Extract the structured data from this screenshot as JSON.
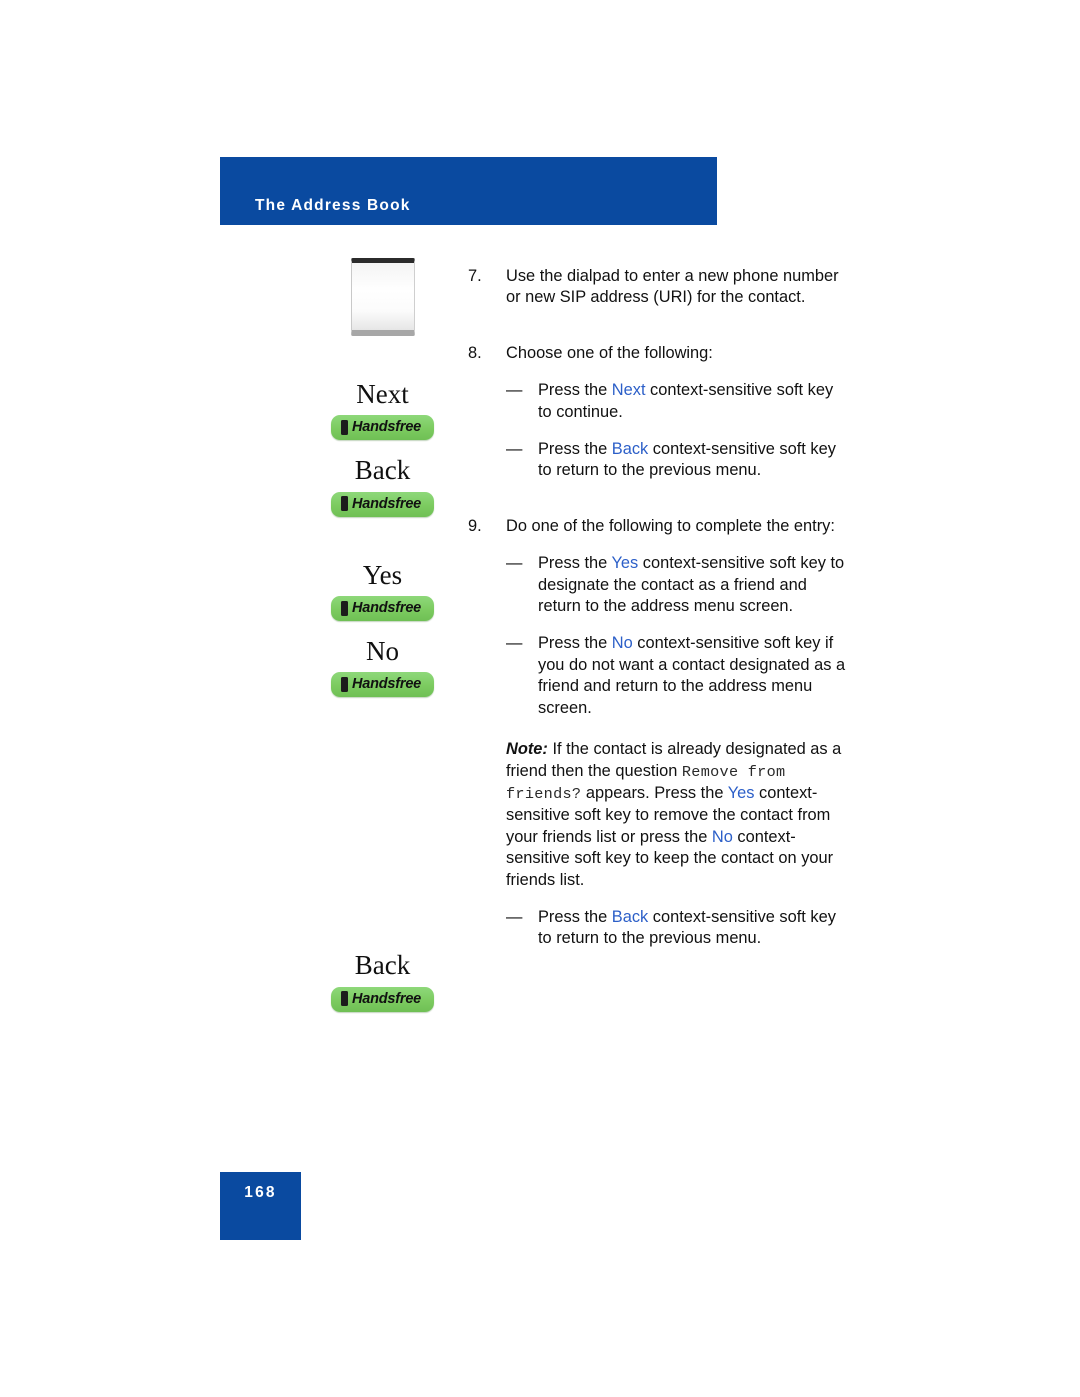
{
  "header": {
    "title": "The Address Book"
  },
  "colors": {
    "banner_blue": "#0A4AA0",
    "softkey_blue": "#2C5FC8",
    "handsfree_green": "#7CCB60"
  },
  "key_graphics": [
    {
      "id": "dialpad-key",
      "label": "",
      "pill_label": ""
    },
    {
      "id": "next-key",
      "label": "Next",
      "pill_label": "Handsfree"
    },
    {
      "id": "back-key",
      "label": "Back",
      "pill_label": "Handsfree"
    },
    {
      "id": "yes-key",
      "label": "Yes",
      "pill_label": "Handsfree"
    },
    {
      "id": "no-key",
      "label": "No",
      "pill_label": "Handsfree"
    },
    {
      "id": "back-key-2",
      "label": "Back",
      "pill_label": "Handsfree"
    }
  ],
  "steps": {
    "step7": {
      "number": "7.",
      "text": "Use the dialpad to enter a new phone number or new SIP address (URI) for the contact."
    },
    "step8": {
      "number": "8.",
      "text": "Choose one of the following:",
      "bullets": [
        {
          "dash": "—",
          "before": "Press the ",
          "softkey": "Next",
          "after": " context-sensitive soft key to continue."
        },
        {
          "dash": "—",
          "before": "Press the ",
          "softkey": "Back",
          "after": "  context-sensitive soft key to return to the previous menu."
        }
      ]
    },
    "step9": {
      "number": "9.",
      "text": "Do one of the following to complete the entry:",
      "bullets": [
        {
          "dash": "—",
          "before": "Press the ",
          "softkey": "Yes",
          "after": " context-sensitive soft key to designate the contact as a friend and return to the address menu screen."
        },
        {
          "dash": "—",
          "before": "Press the ",
          "softkey": "No",
          "after": " context-sensitive soft key if you do not want a contact designated as a friend and return to the address menu screen."
        }
      ]
    },
    "final_bullet": {
      "dash": "—",
      "before": "Press the ",
      "softkey": "Back",
      "after": "  context-sensitive soft key to return to the previous menu."
    }
  },
  "note": {
    "label": "Note:",
    "part1": " If the contact is already designated as a friend then the question ",
    "mono": "Remove from friends?",
    "part2": " appears. Press the ",
    "softkey1": "Yes",
    "part3": " context-sensitive soft key to remove the contact from your friends list or press the ",
    "softkey2": "No",
    "part4": " context-sensitive soft key to keep the contact on your friends list."
  },
  "footer": {
    "page_number": "168"
  }
}
